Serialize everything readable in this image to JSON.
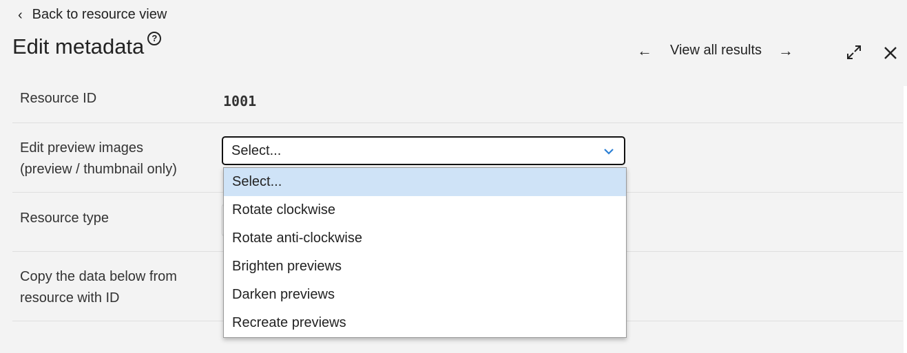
{
  "back_link": {
    "label": "Back to resource view",
    "icon": "chevron-left-icon"
  },
  "page_title": "Edit metadata",
  "help_icon": "question-circle-icon",
  "nav": {
    "prev_icon": "arrow-left-icon",
    "view_all_label": "View all results",
    "next_icon": "arrow-right-icon",
    "expand_icon": "expand-icon",
    "close_icon": "close-icon"
  },
  "fields": {
    "resource_id": {
      "label": "Resource ID",
      "value": "1001"
    },
    "preview_images": {
      "label_line1": "Edit preview images",
      "label_line2": "(preview / thumbnail only)",
      "selected": "Select...",
      "options": [
        "Select...",
        "Rotate clockwise",
        "Rotate anti-clockwise",
        "Brighten previews",
        "Darken previews",
        "Recreate previews"
      ],
      "highlighted_index": 0
    },
    "resource_type": {
      "label": "Resource type"
    },
    "copy_from": {
      "label_line1": "Copy the data below from",
      "label_line2": "resource with ID"
    }
  },
  "colors": {
    "page_bg": "#f3f3f3",
    "dropdown_highlight": "#cfe3f7",
    "chevron_accent": "#2b7fd4"
  }
}
